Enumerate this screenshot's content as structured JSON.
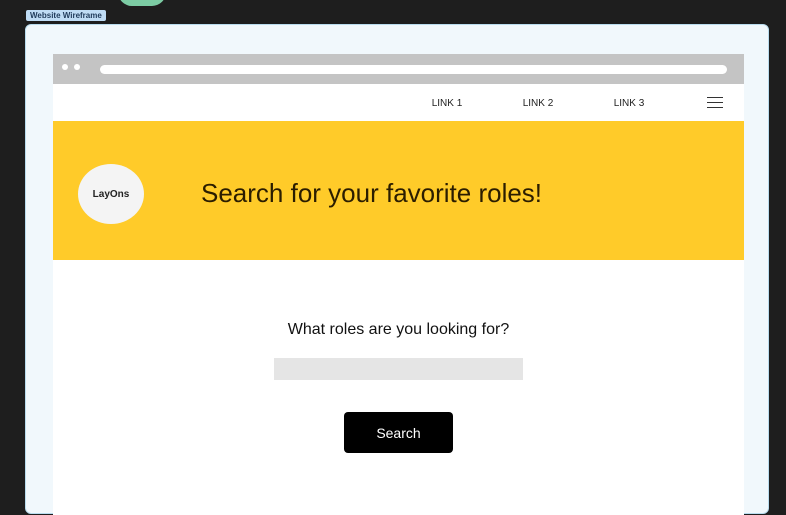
{
  "frame": {
    "label": "Website Wireframe"
  },
  "nav": {
    "links": [
      "LINK 1",
      "LINK 2",
      "LINK 3"
    ],
    "menu_icon": "hamburger-menu-icon"
  },
  "hero": {
    "logo_text": "LayOns",
    "title": "Search for your favorite roles!",
    "background": "#ffcb29"
  },
  "search": {
    "question": "What roles are you looking for?",
    "input_value": "",
    "placeholder": "",
    "button_label": "Search"
  }
}
